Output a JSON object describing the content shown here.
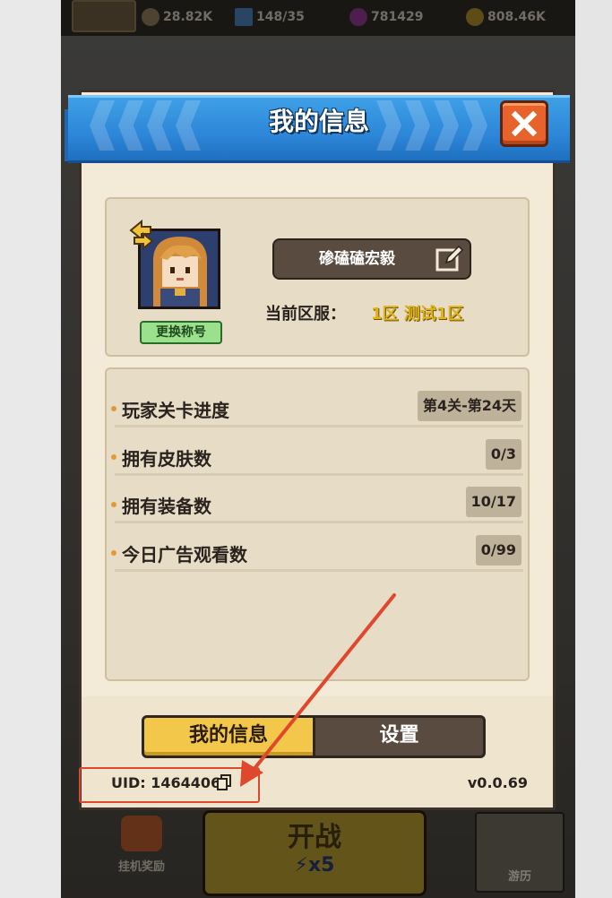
{
  "topbar": {
    "resources": [
      {
        "name": "power",
        "value": "28.82K"
      },
      {
        "name": "energy",
        "value": "148/35"
      },
      {
        "name": "gems",
        "value": "781429"
      },
      {
        "name": "gold",
        "value": "808.46K"
      }
    ]
  },
  "background": {
    "level_number": "4",
    "bottom_left_label": "挂机奖励",
    "bottom_center_label": "开战",
    "bottom_center_cost": "x5",
    "bottom_right_label": "游历"
  },
  "modal": {
    "title": "我的信息",
    "profile": {
      "nickname": "碜磕磕宏毅",
      "rename_label": "更换称号",
      "server_label": "当前区服：",
      "server_value": "1区 测试1区"
    },
    "stats": [
      {
        "label": "玩家关卡进度",
        "value": "第4关-第24天"
      },
      {
        "label": "拥有皮肤数",
        "value": "0/3"
      },
      {
        "label": "拥有装备数",
        "value": "10/17"
      },
      {
        "label": "今日广告观看数",
        "value": "0/99"
      }
    ],
    "tabs": {
      "active": "我的信息",
      "inactive": "设置"
    },
    "footer": {
      "uid": "UID: 1464406",
      "version": "v0.0.69"
    }
  },
  "colors": {
    "banner": "#2d86d8",
    "close": "#e8622b",
    "tab_active": "#f3c84a",
    "server_value": "#e0b418",
    "annotation": "#e0482e"
  }
}
